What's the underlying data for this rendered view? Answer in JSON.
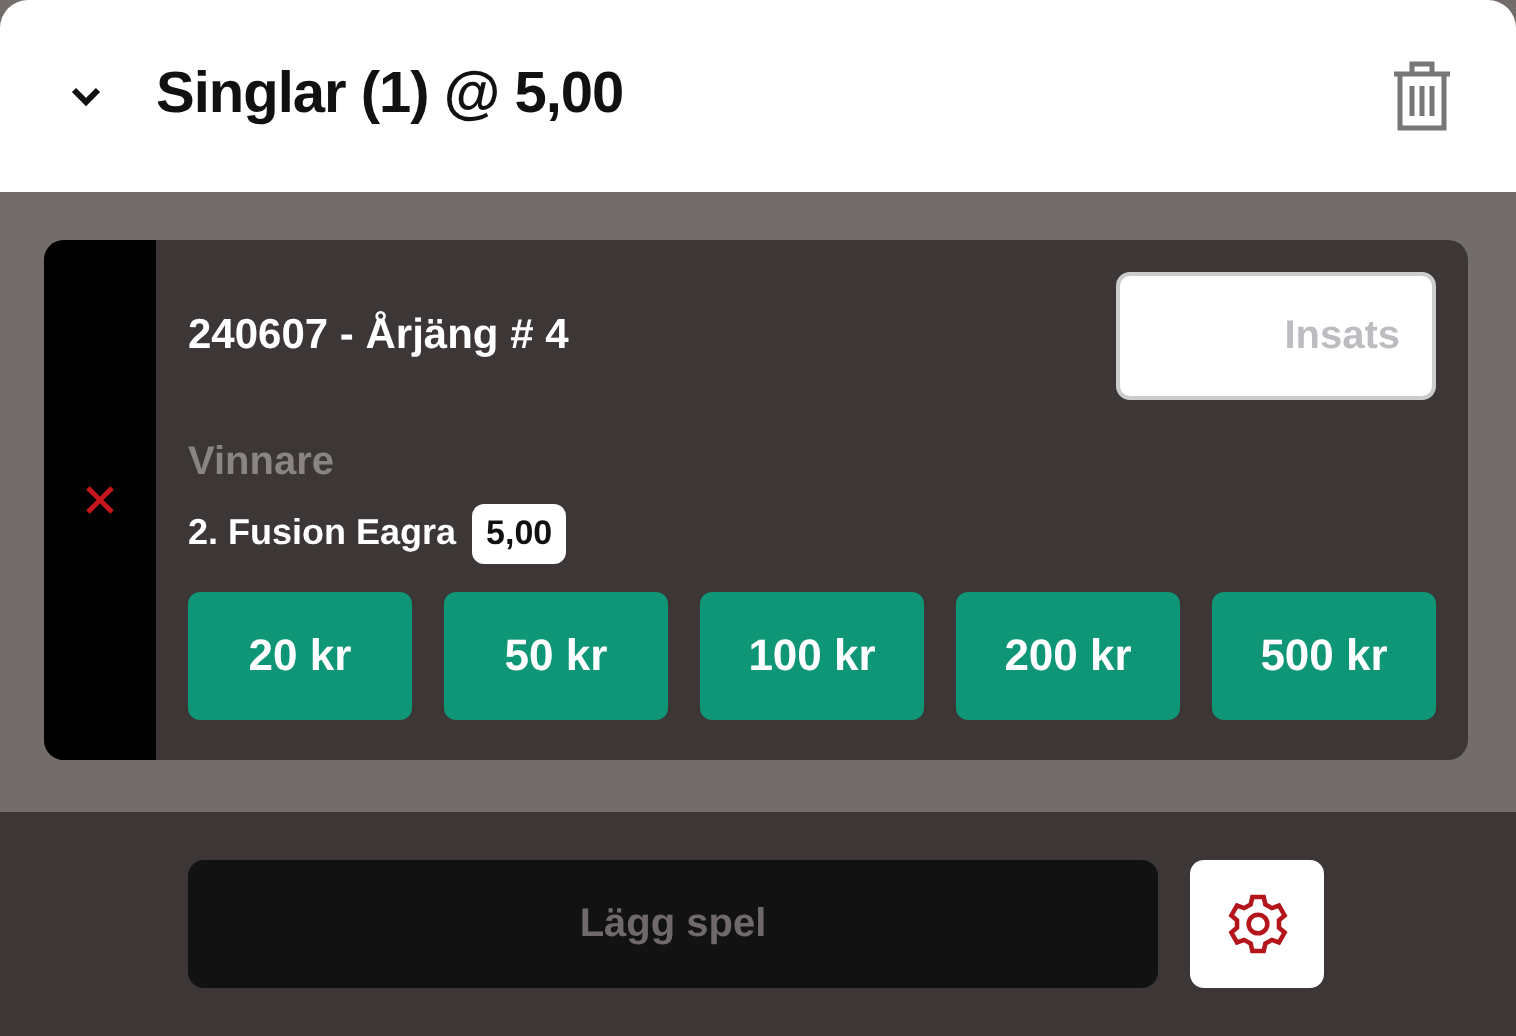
{
  "header": {
    "title": "Singlar (1) @ 5,00",
    "expanded": true
  },
  "bets": [
    {
      "race": "240607 - Årjäng # 4",
      "stake": {
        "placeholder": "Insats"
      },
      "market": "Vinnare",
      "selection": "2. Fusion Eagra",
      "odds": "5,00",
      "quick_stakes": [
        "20 kr",
        "50 kr",
        "100 kr",
        "200 kr",
        "500 kr"
      ]
    }
  ],
  "footer": {
    "submit": {
      "label": "Lägg spel",
      "disabled": true
    }
  }
}
